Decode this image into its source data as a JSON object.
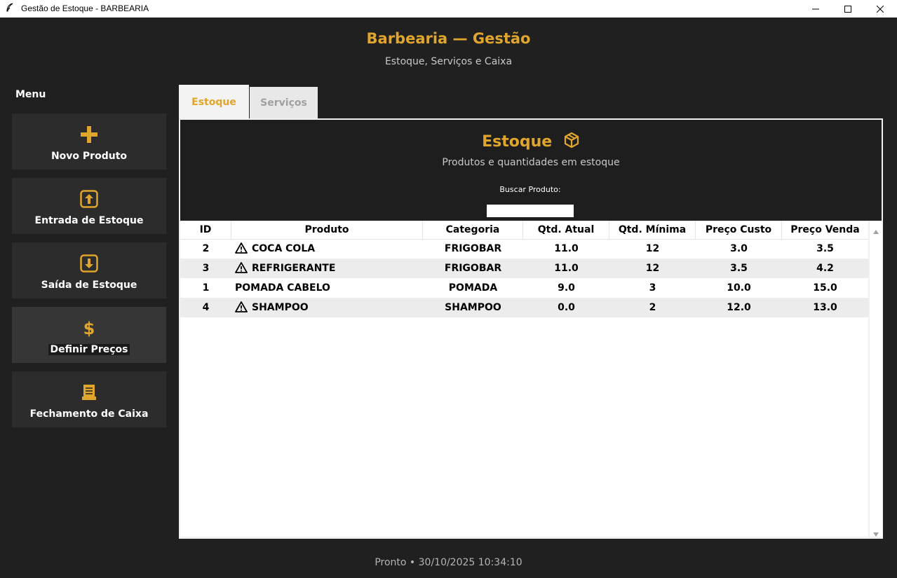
{
  "window": {
    "title": "Gestão de Estoque - BARBEARIA"
  },
  "header": {
    "title": "Barbearia — Gestão",
    "subtitle": "Estoque, Serviços e Caixa"
  },
  "sidebar": {
    "title": "Menu",
    "items": [
      {
        "label": "Novo Produto",
        "icon": "plus-icon"
      },
      {
        "label": "Entrada de Estoque",
        "icon": "arrow-up-box-icon"
      },
      {
        "label": "Saída de Estoque",
        "icon": "arrow-down-box-icon"
      },
      {
        "label": "Definir Preços",
        "icon": "dollar-icon"
      },
      {
        "label": "Fechamento de Caixa",
        "icon": "receipt-icon"
      }
    ]
  },
  "tabs": [
    {
      "label": "Estoque",
      "active": true
    },
    {
      "label": "Serviços",
      "active": false
    }
  ],
  "panel": {
    "title": "Estoque",
    "subtitle": "Produtos e quantidades em estoque",
    "search_label": "Buscar Produto:",
    "search_value": ""
  },
  "table": {
    "columns": [
      "ID",
      "Produto",
      "Categoria",
      "Qtd. Atual",
      "Qtd. Mínima",
      "Preço Custo",
      "Preço Venda"
    ],
    "rows": [
      {
        "id": "2",
        "produto": "COCA COLA",
        "categoria": "FRIGOBAR",
        "qtd_atual": "11.0",
        "qtd_minima": "12",
        "preco_custo": "3.0",
        "preco_venda": "3.5",
        "warning": true
      },
      {
        "id": "3",
        "produto": "REFRIGERANTE",
        "categoria": "FRIGOBAR",
        "qtd_atual": "11.0",
        "qtd_minima": "12",
        "preco_custo": "3.5",
        "preco_venda": "4.2",
        "warning": true
      },
      {
        "id": "1",
        "produto": "POMADA CABELO",
        "categoria": "POMADA",
        "qtd_atual": "9.0",
        "qtd_minima": "3",
        "preco_custo": "10.0",
        "preco_venda": "15.0",
        "warning": false
      },
      {
        "id": "4",
        "produto": "SHAMPOO",
        "categoria": "SHAMPOO",
        "qtd_atual": "0.0",
        "qtd_minima": "2",
        "preco_custo": "12.0",
        "preco_venda": "13.0",
        "warning": true
      }
    ]
  },
  "status": "Pronto • 30/10/2025 10:34:10",
  "colors": {
    "accent": "#e0a52c",
    "background": "#202020",
    "button": "#2c2c2c"
  }
}
